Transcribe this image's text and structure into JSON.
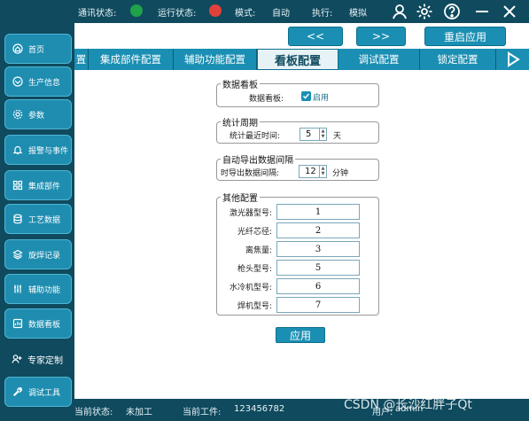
{
  "colors": {
    "bg": "#0f4a5e",
    "accent": "#1a8fb3",
    "dot_comm": "#1fa24a",
    "dot_run": "#e0413a"
  },
  "statusbar": {
    "comm_label": "通讯状态:",
    "run_label": "运行状态:",
    "mode_label": "模式:",
    "mode_value": "自动",
    "exec_label": "执行:",
    "exec_value": "模拟"
  },
  "window_controls": [
    "user-icon",
    "gear-icon",
    "help-icon",
    "minimize-icon",
    "close-icon"
  ],
  "sidebar": {
    "items": [
      {
        "label": "首页",
        "icon": "home-icon"
      },
      {
        "label": "生产信息",
        "icon": "target-icon"
      },
      {
        "label": "参数",
        "icon": "gear-icon"
      },
      {
        "label": "报警与事件",
        "icon": "bell-icon"
      },
      {
        "label": "集成部件",
        "icon": "grid-icon"
      },
      {
        "label": "工艺数据",
        "icon": "database-icon"
      },
      {
        "label": "旋焊记录",
        "icon": "layers-icon"
      },
      {
        "label": "辅助功能",
        "icon": "sliders-icon"
      },
      {
        "label": "数据看板",
        "icon": "board-icon"
      },
      {
        "label": "专家定制",
        "icon": "user-plus-icon"
      },
      {
        "label": "调试工具",
        "icon": "wrench-icon"
      }
    ]
  },
  "toolbar": {
    "prev_label": "<<",
    "next_label": ">>",
    "restart_label": "重启应用"
  },
  "tabs": [
    {
      "label": "置"
    },
    {
      "label": "集成部件配置"
    },
    {
      "label": "辅助功能配置"
    },
    {
      "label": "看板配置"
    },
    {
      "label": "调试配置"
    },
    {
      "label": "锁定配置"
    }
  ],
  "dashboard": {
    "title": "数据看板",
    "label": "数据看板:",
    "checkbox_label": "启用"
  },
  "stats": {
    "title": "统计周期",
    "label": "统计最近时间:",
    "value": "5",
    "unit": "天"
  },
  "export": {
    "title": "自动导出数据间隔",
    "label": "时导出数据间隔:",
    "value": "12",
    "unit": "分钟"
  },
  "other": {
    "title": "其他配置",
    "fields": [
      {
        "label": "激光器型号:",
        "value": "1"
      },
      {
        "label": "光纤芯径:",
        "value": "2"
      },
      {
        "label": "离焦量:",
        "value": "3"
      },
      {
        "label": "枪头型号:",
        "value": "5"
      },
      {
        "label": "水冷机型号:",
        "value": "6"
      },
      {
        "label": "焊机型号:",
        "value": "7"
      }
    ]
  },
  "apply_label": "应用",
  "bottom": {
    "state_label": "当前状态:",
    "state_value": "未加工",
    "workpiece_label": "当前工件:",
    "workpiece_value": "123456782",
    "user_label": "用户:",
    "user_value": "admin"
  },
  "watermark": "CSDN @长沙红胖子Qt"
}
